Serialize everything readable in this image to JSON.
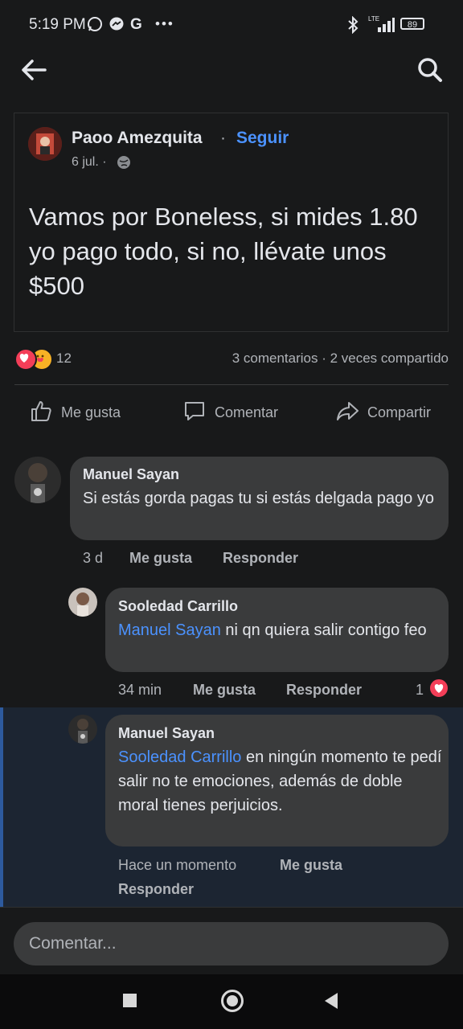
{
  "status_bar": {
    "time": "5:19 PM",
    "notif_icons": [
      "whatsapp-icon",
      "messenger-icon",
      "google-icon",
      "more-dots-icon"
    ],
    "network": "LTE",
    "battery": "89"
  },
  "post": {
    "author": "Paoo Amezquita",
    "separator": "·",
    "follow_label": "Seguir",
    "date": "6 jul. ·",
    "text": "Vamos por Boneless, si mides 1.80 yo pago todo, si no, llévate unos $500",
    "reaction_count": "12",
    "stats": "3 comentarios · 2 veces compartido"
  },
  "actions": {
    "like": "Me gusta",
    "comment": "Comentar",
    "share": "Compartir"
  },
  "comments": [
    {
      "name": "Manuel Sayan",
      "text": "Si estás gorda pagas tu si estás delgada pago yo",
      "time": "3 d",
      "like": "Me gusta",
      "reply": "Responder"
    },
    {
      "name": "Sooledad Carrillo",
      "mention": "Manuel Sayan",
      "text": " ni qn quiera salir contigo feo",
      "time": "34 min",
      "like": "Me gusta",
      "reply": "Responder",
      "reactions": "1"
    },
    {
      "name": "Manuel Sayan",
      "mention": "Sooledad Carrillo",
      "text": " en ningún momento te pedí salir no te emociones, además de doble moral tienes perjuicios.",
      "time": "Hace un momento",
      "like": "Me gusta",
      "reply": "Responder"
    }
  ],
  "composer": {
    "placeholder": "Comentar..."
  },
  "colors": {
    "background": "#18191a",
    "bubble": "#3a3b3c",
    "link": "#4b92ff",
    "highlight": "#1c2532"
  }
}
